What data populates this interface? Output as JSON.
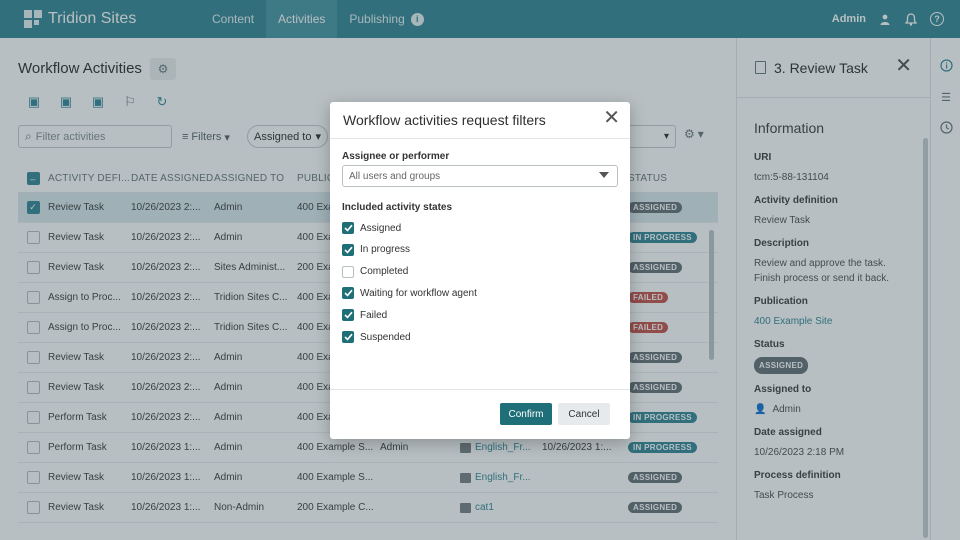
{
  "topbar": {
    "brand": "Tridion Sites",
    "nav": [
      {
        "label": "Content"
      },
      {
        "label": "Activities"
      },
      {
        "label": "Publishing"
      }
    ],
    "user": "Admin",
    "icons": [
      "user-icon",
      "bell-icon",
      "help-icon"
    ]
  },
  "main": {
    "title": "Workflow Activities",
    "search_placeholder": "Filter activities",
    "filters_label": "Filters",
    "assigned_pill": "Assigned to",
    "columns": [
      "ACTIVITY DEFI...",
      "DATE ASSIGNED",
      "ASSIGNED TO",
      "PUBLICA",
      "STATUS"
    ],
    "rows": [
      {
        "def": "Review Task",
        "date": "10/26/2023 2:...",
        "assigned": "Admin",
        "pub": "400 Exa",
        "perf": "",
        "item": "",
        "date2": "",
        "status": "ASSIGNED",
        "kind": "assigned",
        "checked": true,
        "selected": true
      },
      {
        "def": "Review Task",
        "date": "10/26/2023 2:...",
        "assigned": "Admin",
        "pub": "400 Exa",
        "perf": "",
        "item": "",
        "date2": "",
        "status": "IN PROGRESS",
        "kind": "progress",
        "checked": false,
        "selected": false
      },
      {
        "def": "Review Task",
        "date": "10/26/2023 2:...",
        "assigned": "Sites Administ...",
        "pub": "200 Exa",
        "perf": "",
        "item": "",
        "date2": "",
        "status": "ASSIGNED",
        "kind": "assigned",
        "checked": false,
        "selected": false
      },
      {
        "def": "Assign to Proc...",
        "date": "10/26/2023 2:...",
        "assigned": "Tridion Sites C...",
        "pub": "400 Exa",
        "perf": "",
        "item": "",
        "date2": "",
        "status": "FAILED",
        "kind": "failed",
        "checked": false,
        "selected": false
      },
      {
        "def": "Assign to Proc...",
        "date": "10/26/2023 2:...",
        "assigned": "Tridion Sites C...",
        "pub": "400 Exa",
        "perf": "",
        "item": "",
        "date2": "",
        "status": "FAILED",
        "kind": "failed",
        "checked": false,
        "selected": false
      },
      {
        "def": "Review Task",
        "date": "10/26/2023 2:...",
        "assigned": "Admin",
        "pub": "400 Exa",
        "perf": "",
        "item": "",
        "date2": "",
        "status": "ASSIGNED",
        "kind": "assigned",
        "checked": false,
        "selected": false
      },
      {
        "def": "Review Task",
        "date": "10/26/2023 2:...",
        "assigned": "Admin",
        "pub": "400 Exa",
        "perf": "",
        "item": "",
        "date2": "",
        "status": "ASSIGNED",
        "kind": "assigned",
        "checked": false,
        "selected": false
      },
      {
        "def": "Perform Task",
        "date": "10/26/2023 2:...",
        "assigned": "Admin",
        "pub": "400 Exa",
        "perf": "",
        "item": "",
        "date2": "",
        "status": "IN PROGRESS",
        "kind": "progress",
        "checked": false,
        "selected": false
      },
      {
        "def": "Perform Task",
        "date": "10/26/2023 1:...",
        "assigned": "Admin",
        "pub": "400 Example S...",
        "perf": "Admin",
        "item": "English_Fr...",
        "date2": "10/26/2023 1:...",
        "status": "IN PROGRESS",
        "kind": "progress",
        "checked": false,
        "selected": false
      },
      {
        "def": "Review Task",
        "date": "10/26/2023 1:...",
        "assigned": "Admin",
        "pub": "400 Example S...",
        "perf": "",
        "item": "English_Fr...",
        "date2": "",
        "status": "ASSIGNED",
        "kind": "assigned",
        "checked": false,
        "selected": false
      },
      {
        "def": "Review Task",
        "date": "10/26/2023 1:...",
        "assigned": "Non-Admin",
        "pub": "200 Example C...",
        "perf": "",
        "item": "cat1",
        "date2": "",
        "status": "ASSIGNED",
        "kind": "assigned",
        "checked": false,
        "selected": false
      }
    ]
  },
  "panel": {
    "title": "3. Review Task",
    "section": "Information",
    "fields": [
      {
        "label": "URI",
        "value": "tcm:5-88-131104",
        "link": false
      },
      {
        "label": "Activity definition",
        "value": "Review Task",
        "link": false
      },
      {
        "label": "Description",
        "value": "Review and approve the task. Finish process or send it back.",
        "link": false
      },
      {
        "label": "Publication",
        "value": "400 Example Site",
        "link": true
      },
      {
        "label": "Status",
        "value": "ASSIGNED",
        "badge": true
      },
      {
        "label": "Assigned to",
        "value": "Admin",
        "user": true
      },
      {
        "label": "Date assigned",
        "value": "10/26/2023 2:18 PM",
        "link": false
      },
      {
        "label": "Process definition",
        "value": "Task Process",
        "link": false
      }
    ]
  },
  "dialog": {
    "title": "Workflow activities request filters",
    "assignee_label": "Assignee or performer",
    "assignee_value": "All users and groups",
    "states_label": "Included activity states",
    "states": [
      {
        "label": "Assigned",
        "checked": true
      },
      {
        "label": "In progress",
        "checked": true
      },
      {
        "label": "Completed",
        "checked": false
      },
      {
        "label": "Waiting for workflow agent",
        "checked": true
      },
      {
        "label": "Failed",
        "checked": true
      },
      {
        "label": "Suspended",
        "checked": true
      }
    ],
    "confirm_label": "Confirm",
    "cancel_label": "Cancel"
  },
  "colors": {
    "brand": "#3b8a99",
    "primary_button": "#1f6f78",
    "failed": "#c9564f"
  }
}
